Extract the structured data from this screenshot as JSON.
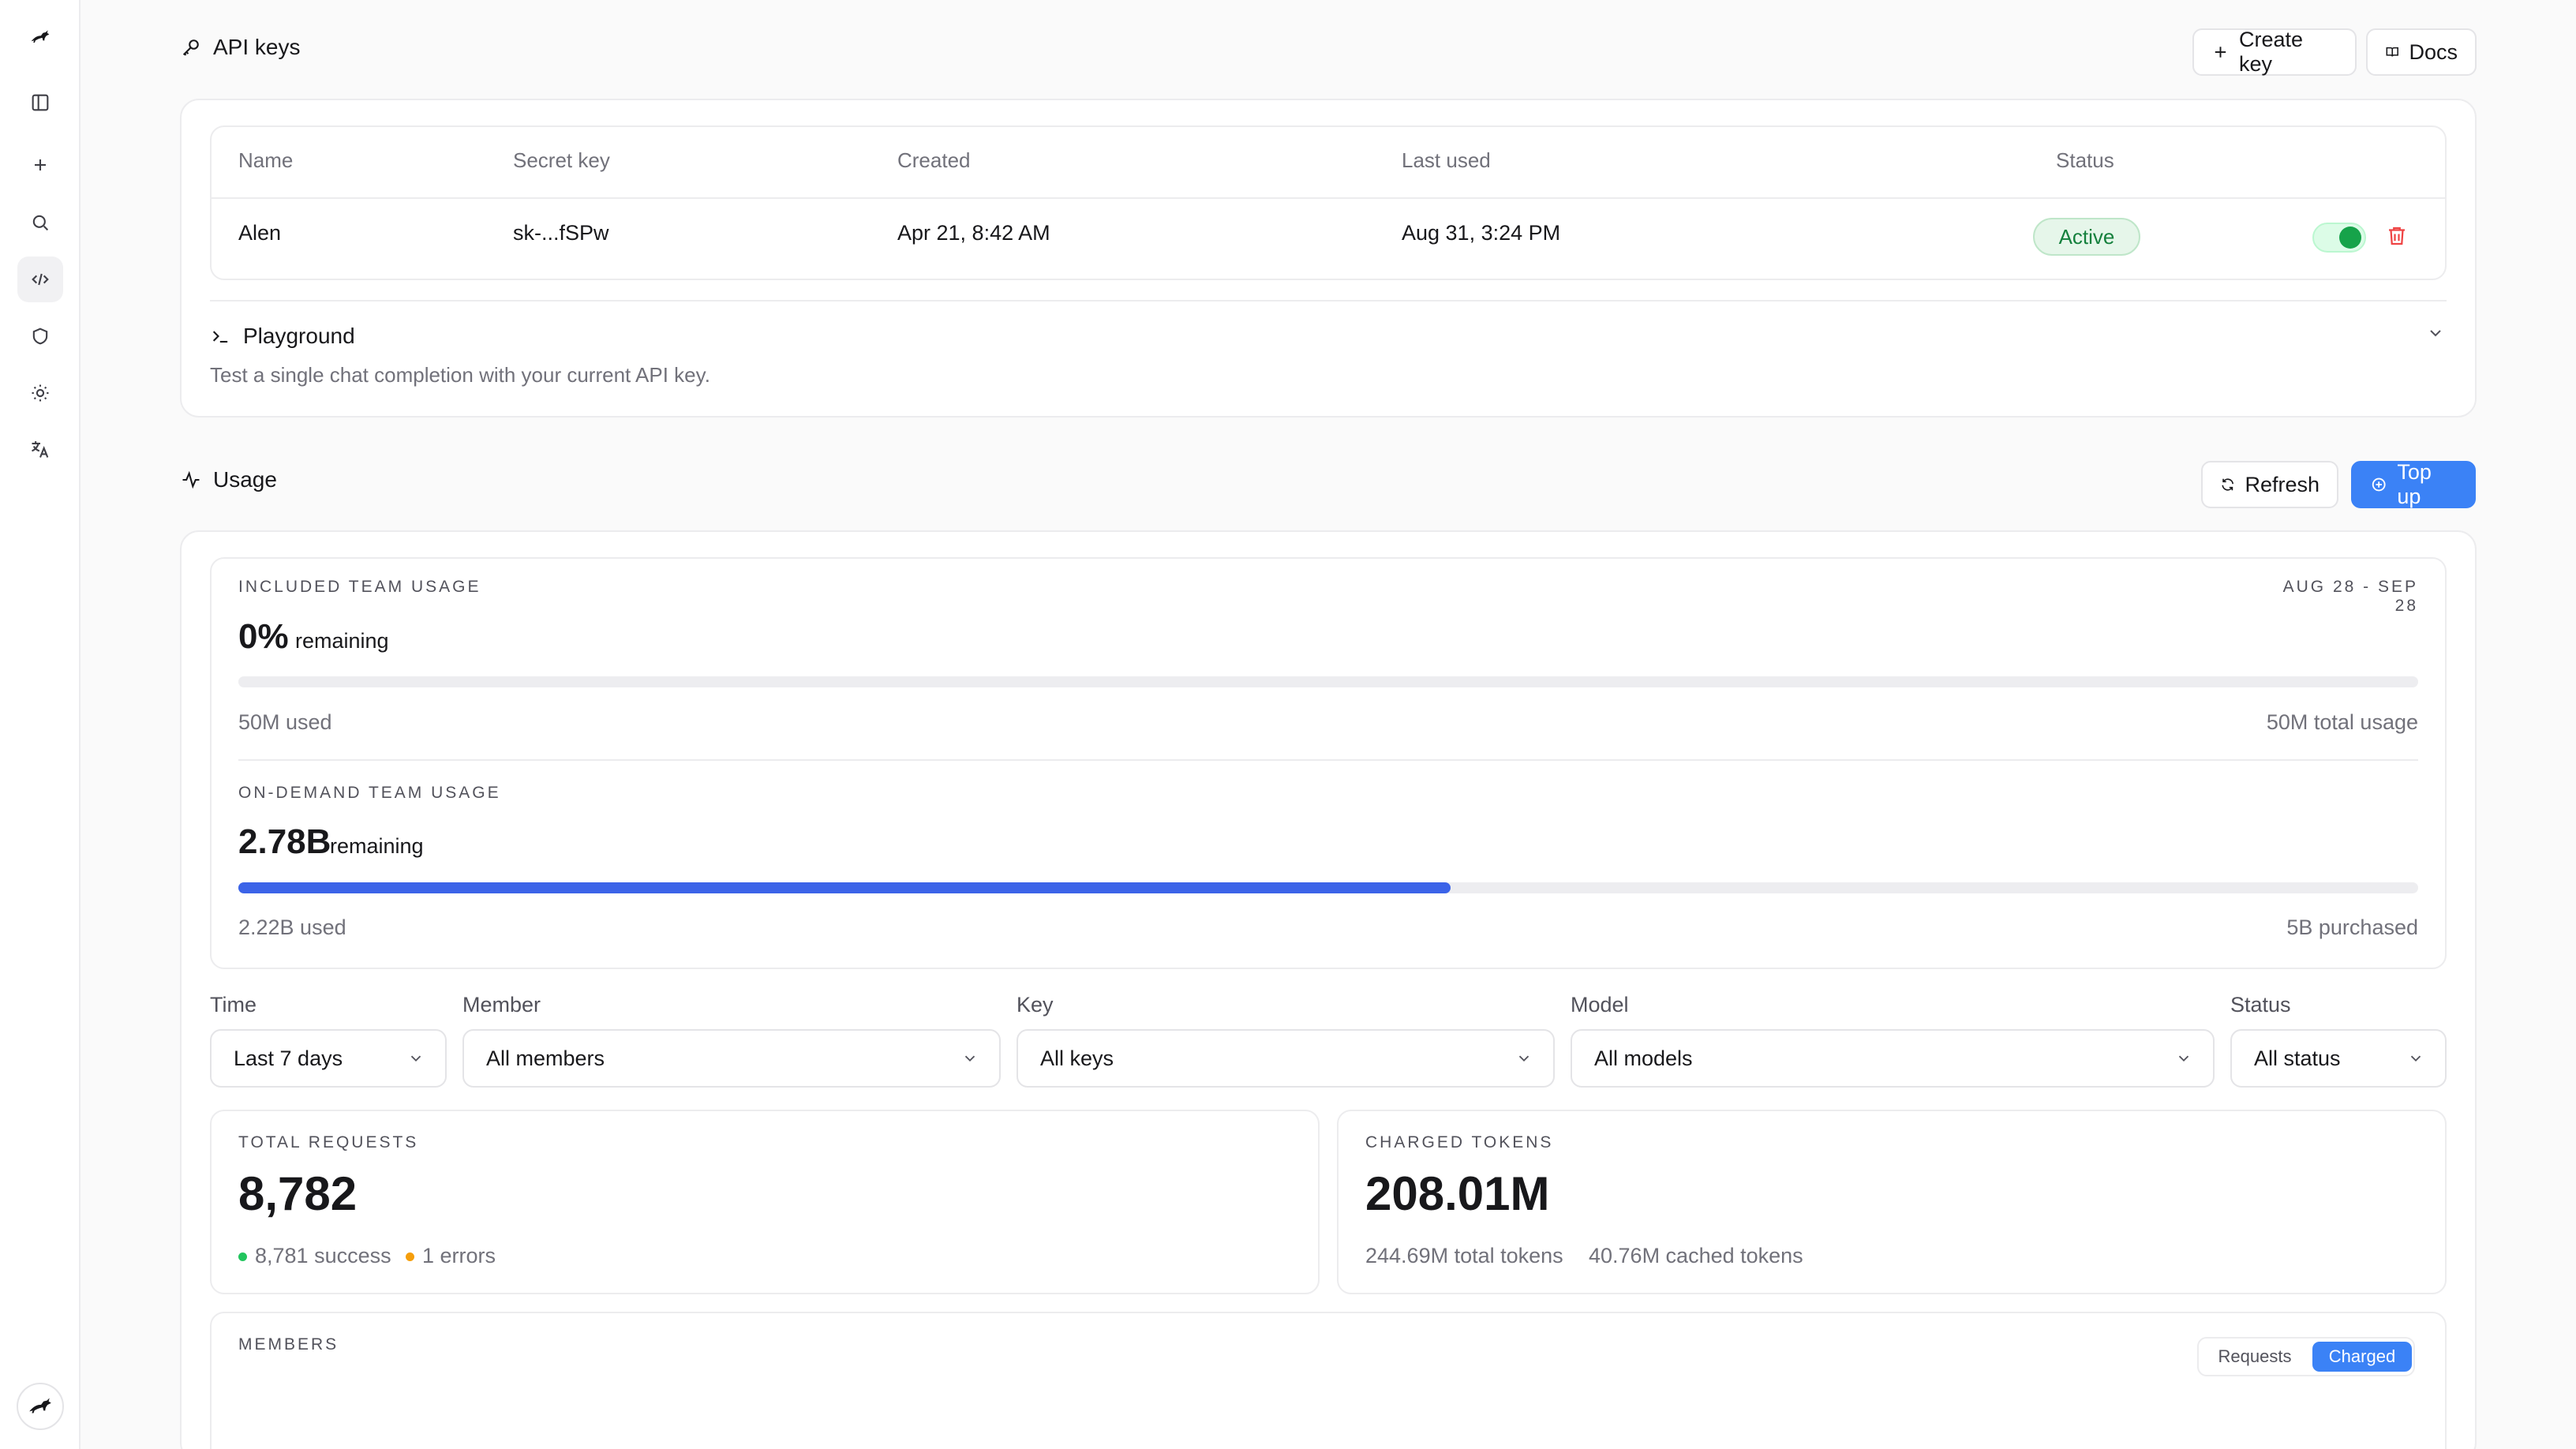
{
  "sidebar": {
    "items": [
      {
        "name": "panel-icon"
      },
      {
        "name": "plus-icon"
      },
      {
        "name": "search-icon"
      },
      {
        "name": "code-icon",
        "active": true
      },
      {
        "name": "shield-icon"
      },
      {
        "name": "sun-icon"
      },
      {
        "name": "translate-icon"
      }
    ]
  },
  "api_keys": {
    "title": "API keys",
    "create_label": "Create key",
    "docs_label": "Docs",
    "columns": [
      "Name",
      "Secret key",
      "Created",
      "Last used",
      "Status"
    ],
    "rows": [
      {
        "name": "Alen",
        "secret": "sk-...fSPw",
        "created": "Apr 21, 8:42 AM",
        "last_used": "Aug 31, 3:24 PM",
        "status": "Active",
        "enabled": true
      }
    ]
  },
  "playground": {
    "title": "Playground",
    "description": "Test a single chat completion with your current API key."
  },
  "usage": {
    "title": "Usage",
    "refresh_label": "Refresh",
    "topup_label": "Top up",
    "included": {
      "label": "INCLUDED TEAM USAGE",
      "period": "AUG 28 - SEP 28",
      "value": "0%",
      "suffix": "remaining",
      "used": "50M used",
      "total": "50M total usage",
      "fill_fraction": 0
    },
    "on_demand": {
      "label": "ON-DEMAND TEAM USAGE",
      "value": "2.78B",
      "suffix": "remaining",
      "used": "2.22B used",
      "total": "5B purchased",
      "fill_fraction": 0.556
    },
    "filters": {
      "time": {
        "label": "Time",
        "value": "Last 7 days"
      },
      "member": {
        "label": "Member",
        "value": "All members"
      },
      "key": {
        "label": "Key",
        "value": "All keys"
      },
      "model": {
        "label": "Model",
        "value": "All models"
      },
      "status": {
        "label": "Status",
        "value": "All status"
      }
    },
    "requests": {
      "label": "TOTAL REQUESTS",
      "value": "8,782",
      "success": "8,781 success",
      "errors": "1 errors",
      "success_color": "#22c55e",
      "error_color": "#f59e0b"
    },
    "tokens": {
      "label": "CHARGED TOKENS",
      "value": "208.01M",
      "total": "244.69M total tokens",
      "cached": "40.76M cached tokens"
    },
    "members": {
      "label": "MEMBERS",
      "toggle": [
        "Requests",
        "Charged"
      ],
      "selected": "Charged"
    }
  },
  "colors": {
    "accent": "#3b82f6",
    "active_green": "#16a34a",
    "danger": "#ef4444"
  }
}
